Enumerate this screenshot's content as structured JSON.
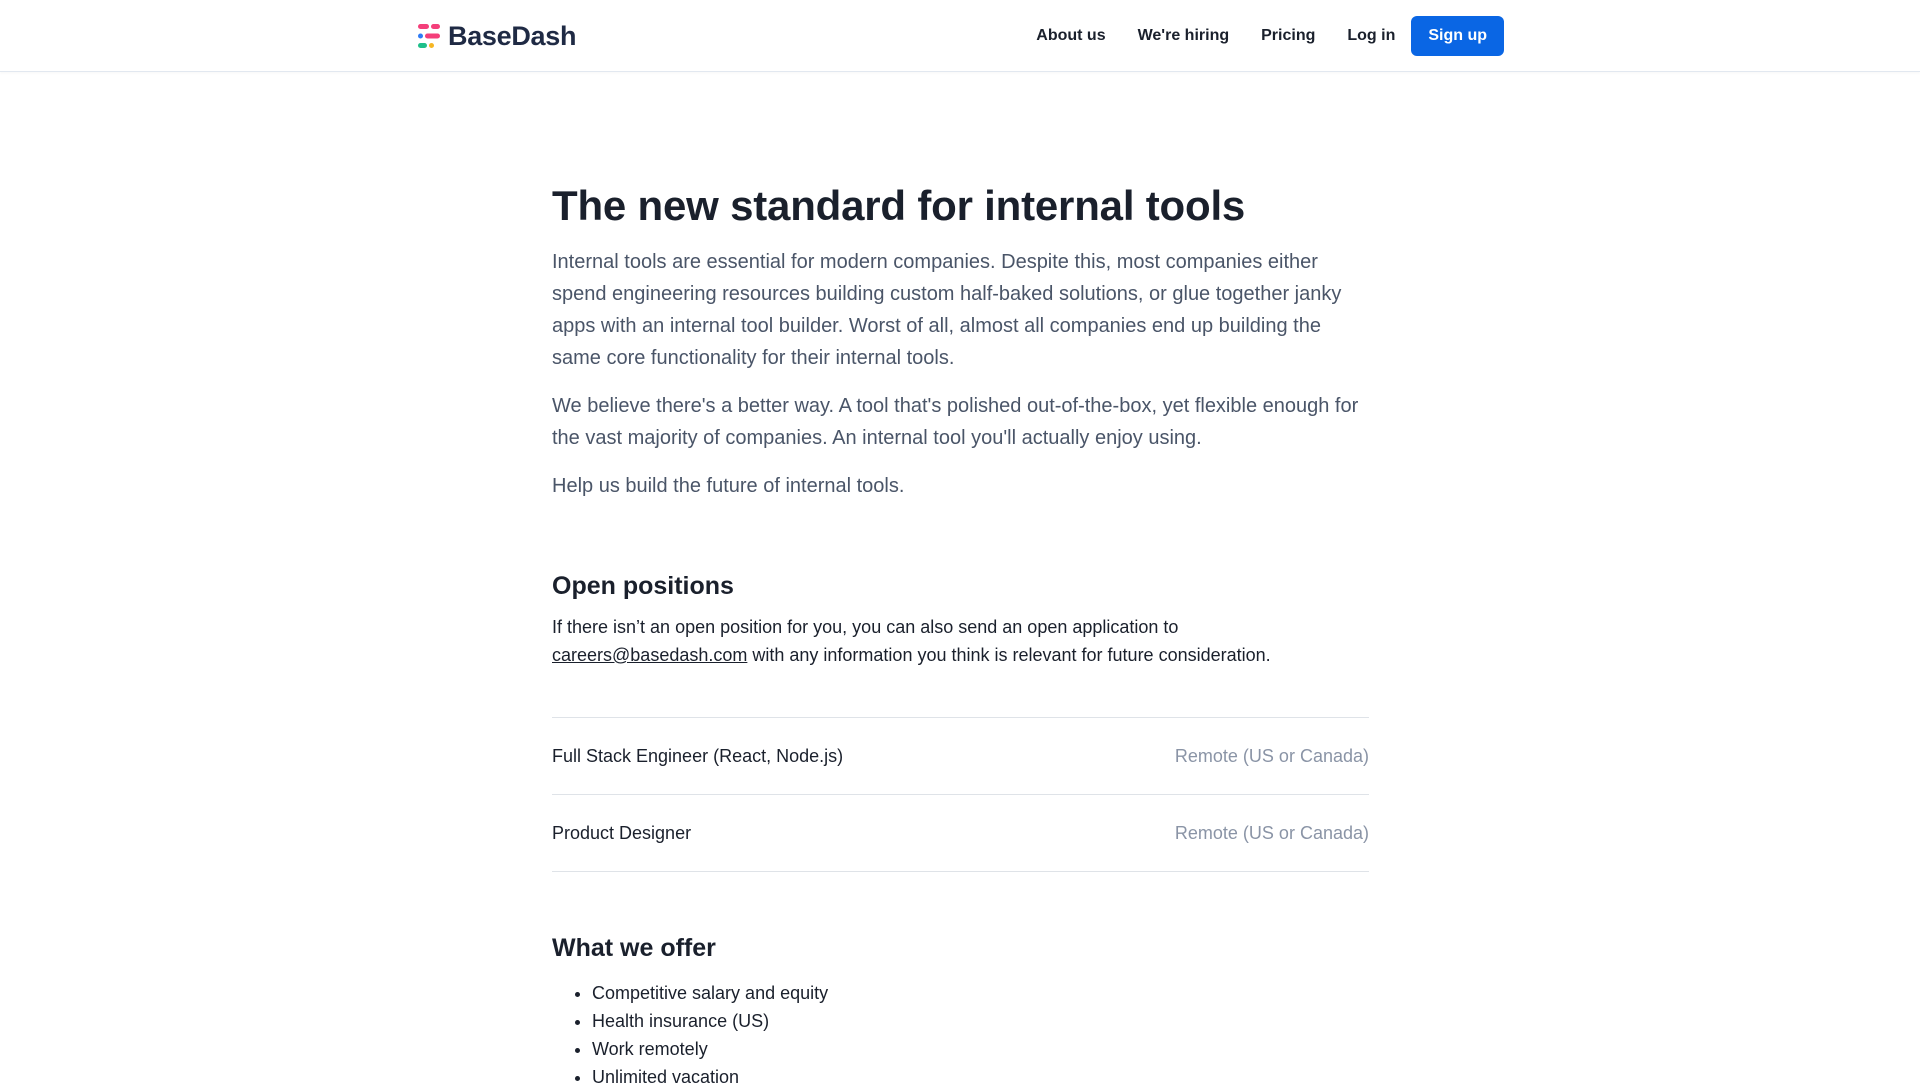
{
  "header": {
    "brand": "BaseDash",
    "nav": [
      {
        "label": "About us"
      },
      {
        "label": "We're hiring"
      },
      {
        "label": "Pricing"
      },
      {
        "label": "Log in"
      }
    ],
    "signup_label": "Sign up"
  },
  "colors": {
    "accent": "#0a66e4",
    "logo_pink": "#f43f7a",
    "logo_green": "#1fbf8a",
    "logo_blue": "#2f7bf6",
    "logo_yellow": "#f6b623"
  },
  "hero": {
    "title": "The new standard for internal tools",
    "paragraphs": [
      "Internal tools are essential for modern companies. Despite this, most companies either spend engineering resources building custom half-baked solutions, or glue together janky apps with an internal tool builder. Worst of all, almost all companies end up building the same core functionality for their internal tools.",
      "We believe there's a better way. A tool that's polished out-of-the-box, yet flexible enough for the vast majority of companies. An internal tool you'll actually enjoy using.",
      "Help us build the future of internal tools."
    ]
  },
  "positions": {
    "title": "Open positions",
    "desc_before": "If there isn’t an open position for you, you can also send an open application to",
    "email": "careers@basedash.com",
    "desc_after": " with any information you think is relevant for future consideration.",
    "jobs": [
      {
        "title": "Full Stack Engineer (React, Node.js)",
        "location": "Remote (US or Canada)"
      },
      {
        "title": "Product Designer",
        "location": "Remote (US or Canada)"
      }
    ]
  },
  "offer": {
    "title": "What we offer",
    "items": [
      "Competitive salary and equity",
      "Health insurance (US)",
      "Work remotely",
      "Unlimited vacation"
    ]
  }
}
